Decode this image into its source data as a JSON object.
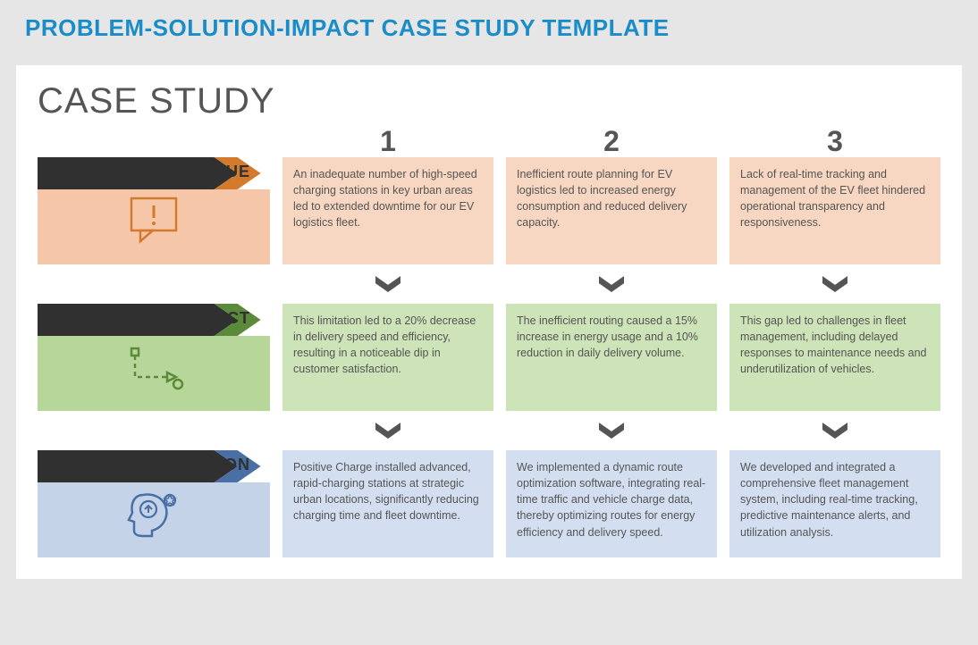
{
  "page_title": "PROBLEM-SOLUTION-IMPACT CASE STUDY TEMPLATE",
  "card_title": "CASE STUDY",
  "columns": [
    "1",
    "2",
    "3"
  ],
  "rows": {
    "issue": {
      "label": "ISSUE",
      "cells": [
        "An inadequate number of high-speed charging stations in key urban areas led to extended downtime for our EV logistics fleet.",
        "Inefficient route planning for EV logistics led to increased energy consumption and reduced delivery capacity.",
        "Lack of real-time tracking and management of the EV fleet hindered operational transparency and responsiveness."
      ]
    },
    "impact": {
      "label": "IMPACT",
      "cells": [
        "This limitation led to a 20% decrease in delivery speed and efficiency, resulting in a noticeable dip in customer satisfaction.",
        "The inefficient routing caused a 15% increase in energy usage and a 10% reduction in daily delivery volume.",
        "This gap led to challenges in fleet management, including delayed responses to maintenance needs and underutilization of vehicles."
      ]
    },
    "solution": {
      "label": "SOLUTION",
      "cells": [
        "Positive Charge installed advanced, rapid-charging stations at strategic urban locations, significantly reducing charging time and fleet downtime.",
        "We implemented a dynamic route optimization software, integrating real-time traffic and vehicle charge data, thereby optimizing routes for energy efficiency and delivery speed.",
        "We developed and integrated a comprehensive fleet management system, including real-time tracking, predictive maintenance alerts, and utilization analysis."
      ]
    }
  }
}
